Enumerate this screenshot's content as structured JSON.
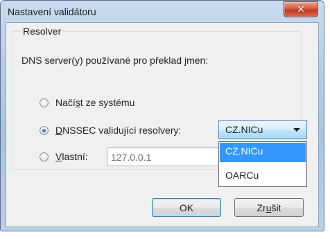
{
  "window": {
    "title": "Nastavení validátoru",
    "close_glyph": "✕"
  },
  "group": {
    "legend": "Resolver",
    "description": "DNS server(y) používané pro překlad jmen:"
  },
  "options": {
    "system": {
      "label_pre": "Načí",
      "label_u": "s",
      "label_post": "t ze systému",
      "checked": false
    },
    "dnssec": {
      "label_pre": "",
      "label_u": "D",
      "label_post": "NSSEC validující resolvery:",
      "checked": true
    },
    "custom": {
      "label_pre": "",
      "label_u": "V",
      "label_post": "lastní:",
      "checked": false
    }
  },
  "combo": {
    "selected": "CZ.NICu",
    "options": [
      "CZ.NICu",
      "OARCu"
    ],
    "highlighted_index": 0
  },
  "custom_field": {
    "value": "127.0.0.1"
  },
  "buttons": {
    "ok": "OK",
    "cancel_pre": "Zr",
    "cancel_u": "u",
    "cancel_post": "šit"
  },
  "colors": {
    "selection": "#3399ff",
    "close_button": "#c0391f"
  }
}
